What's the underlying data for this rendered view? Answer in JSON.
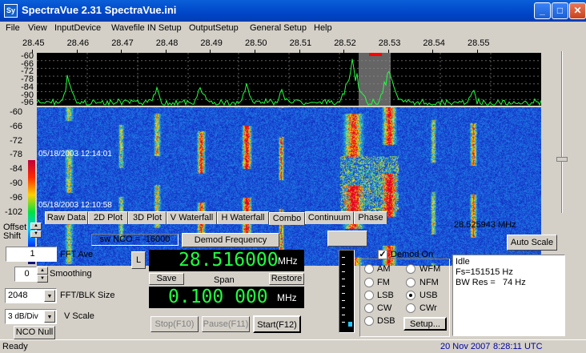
{
  "window": {
    "title": "SpectraVue 2.31 SpectraVue.ini",
    "app_icon_text": "Sy",
    "min_icon": "minimize-icon",
    "max_icon": "maximize-icon",
    "close_icon": "close-icon",
    "min_glyph": "_",
    "max_glyph": "□",
    "close_glyph": "✕"
  },
  "menu": [
    "File",
    "View",
    "InputDevice",
    "Wavefile IN Setup",
    "OutputSetup",
    "General Setup",
    "Help"
  ],
  "freq_scale": [
    "28.45",
    "28.46",
    "28.47",
    "28.48",
    "28.49",
    "28.50",
    "28.51",
    "28.52",
    "28.53",
    "28.54",
    "28.55"
  ],
  "spectrum_db_labels": [
    "-60",
    "-66",
    "-72",
    "-78",
    "-84",
    "-90",
    "-96"
  ],
  "waterfall_db_labels": [
    "-60",
    "-66",
    "-72",
    "-78",
    "-84",
    "-90",
    "-96",
    "-102"
  ],
  "waterfall_timestamps": [
    "05/18/2003 12:14:01",
    "05/18/2003 12:10:58"
  ],
  "tabs": [
    "Raw Data",
    "2D Plot",
    "3D Plot",
    "V Waterfall",
    "H Waterfall",
    "Combo",
    "Continuum",
    "Phase"
  ],
  "active_tab": "Combo",
  "cursor_freq": "28.525943 MHz",
  "auto_scale_label": "Auto Scale",
  "offset_label": "Offset",
  "shift_label": "Shift",
  "sw_nco": "sw NCO = -16000",
  "demod_freq_button": "Demod Frequency",
  "fft_ave": {
    "value": "1",
    "label": "FFT Ave"
  },
  "smoothing": {
    "value": "0",
    "label": "Smoothing"
  },
  "fft_blk": {
    "value": "2048",
    "label": "FFT/BLK Size"
  },
  "vscale": {
    "value": "3 dB/Div",
    "label": "V Scale"
  },
  "nco_null_label": "NCO Null",
  "l_button": "L",
  "center_freq": {
    "value": "28.516000",
    "unit": "MHz"
  },
  "save_label": "Save",
  "span_label": "Span",
  "restore_label": "Restore",
  "span_freq": {
    "value": "0.100 000",
    "unit": "MHz"
  },
  "stop_label": "Stop(F10)",
  "pause_label": "Pause(F11)",
  "start_label": "Start(F12)",
  "demod_on_label": "Demod On",
  "demod_on_checked": true,
  "modes_left": [
    "AM",
    "FM",
    "LSB",
    "CW",
    "DSB"
  ],
  "modes_right": [
    "WFM",
    "NFM",
    "USB",
    "CWr"
  ],
  "selected_mode": "USB",
  "setup_label": "Setup...",
  "info_lines": [
    "Idle",
    "Fs=151515 Hz",
    "BW Res =   74 Hz"
  ],
  "status_left": "Ready",
  "status_date": "20 Nov 2007",
  "status_time": "8:28:11 UTC",
  "colors": {
    "trace": "#20ff40",
    "lcd": "#20ff40",
    "marker": "#ff0000",
    "titlebar": "#0a5fd8"
  }
}
